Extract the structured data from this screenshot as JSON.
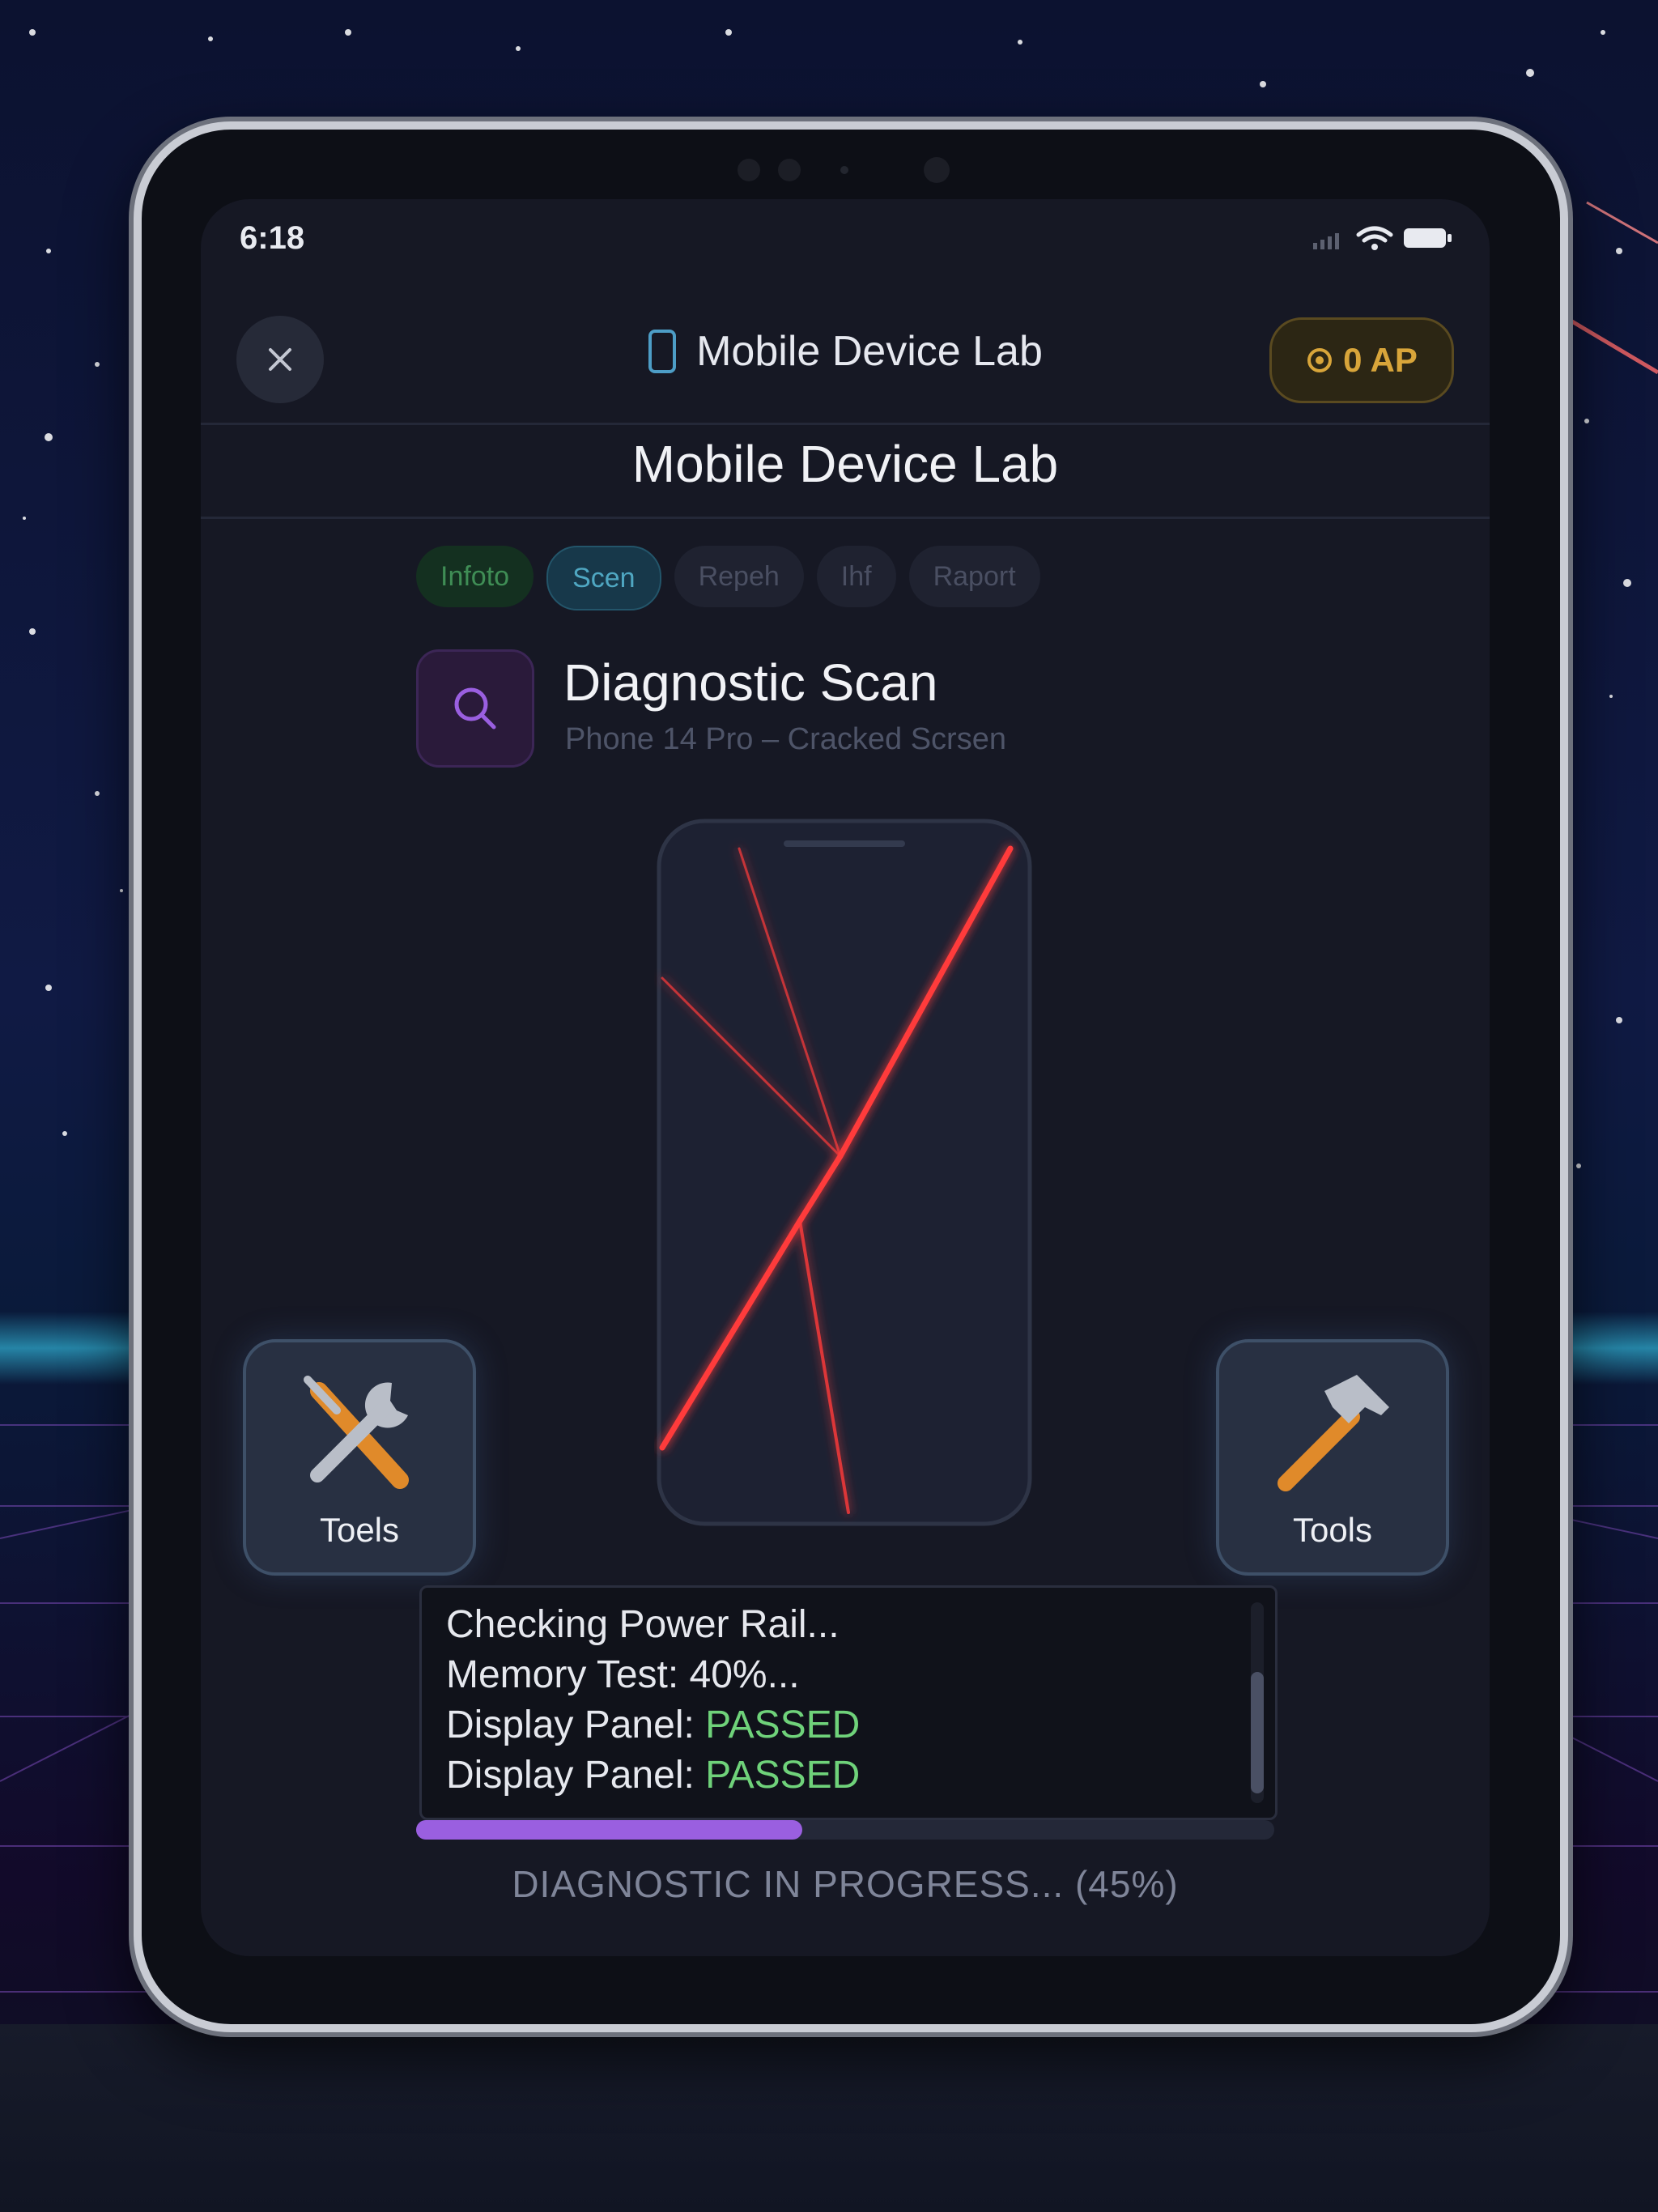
{
  "status_bar": {
    "time": "6:18"
  },
  "header": {
    "title": "Mobile Device Lab",
    "ap_badge": "0 AP"
  },
  "page_title": "Mobile Device Lab",
  "tabs": [
    {
      "label": "Infoto"
    },
    {
      "label": "Scen"
    },
    {
      "label": "Repeh"
    },
    {
      "label": "Ihf"
    },
    {
      "label": "Raport"
    }
  ],
  "scan": {
    "title": "Diagnostic Scan",
    "subtitle": "Phone 14 Pro – Cracked Scrsen"
  },
  "tools": {
    "left_label": "Toels",
    "right_label": "Tools"
  },
  "log": {
    "lines": [
      {
        "text": "Checking Power Rail..."
      },
      {
        "text": "Memory Test: 40%..."
      },
      {
        "prefix": "Display Panel: ",
        "status": "PASSED"
      },
      {
        "prefix": "Display Panel: ",
        "status": "PASSED"
      }
    ]
  },
  "progress": {
    "fraction": 0.45,
    "text": "DIAGNOSTIC IN PROGRESS... (45%)"
  },
  "colors": {
    "accent": "#9a5fe0",
    "pass": "#6fd27a",
    "ap_gold": "#d8a53a",
    "crack_red": "#ff3b3b"
  }
}
